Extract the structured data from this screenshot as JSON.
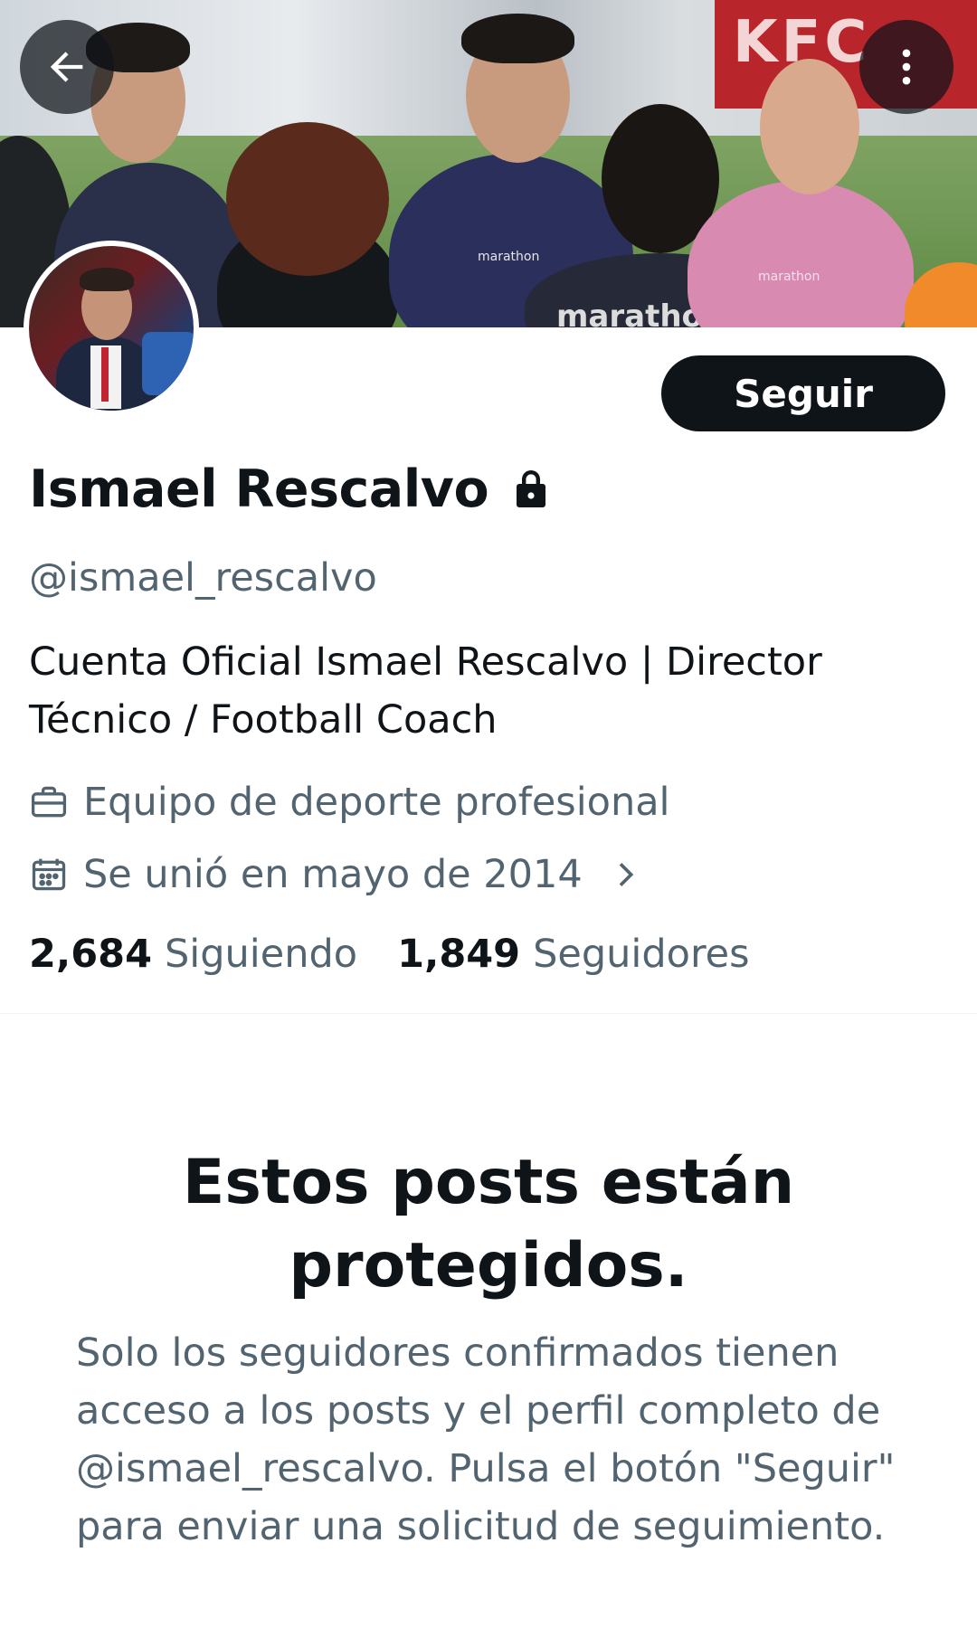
{
  "profile": {
    "display_name": "Ismael Rescalvo",
    "handle": "@ismael_rescalvo",
    "bio": "Cuenta Oficial Ismael Rescalvo | Director Técnico / Football Coach",
    "category": "Equipo de deporte profesional",
    "joined": "Se unió en mayo de 2014",
    "following_count": "2,684",
    "following_label": "Siguiendo",
    "followers_count": "1,849",
    "followers_label": "Seguidores"
  },
  "actions": {
    "follow_label": "Seguir"
  },
  "banner": {
    "text": "marathon",
    "sign": "KFC"
  },
  "protected": {
    "title": "Estos posts están protegidos.",
    "description": "Solo los seguidores confirmados tienen acceso a los posts y el perfil completo de @ismael_rescalvo. Pulsa el botón \"Seguir\" para enviar una solicitud de seguimiento."
  },
  "icons": {
    "back": "arrow-left-icon",
    "more": "more-vertical-icon",
    "lock": "lock-icon",
    "category": "briefcase-icon",
    "joined": "calendar-icon",
    "chevron": "chevron-right-icon"
  },
  "colors": {
    "text_primary": "#0f1419",
    "text_secondary": "#536471",
    "button_bg": "#0f1419",
    "divider": "#eff3f4"
  }
}
